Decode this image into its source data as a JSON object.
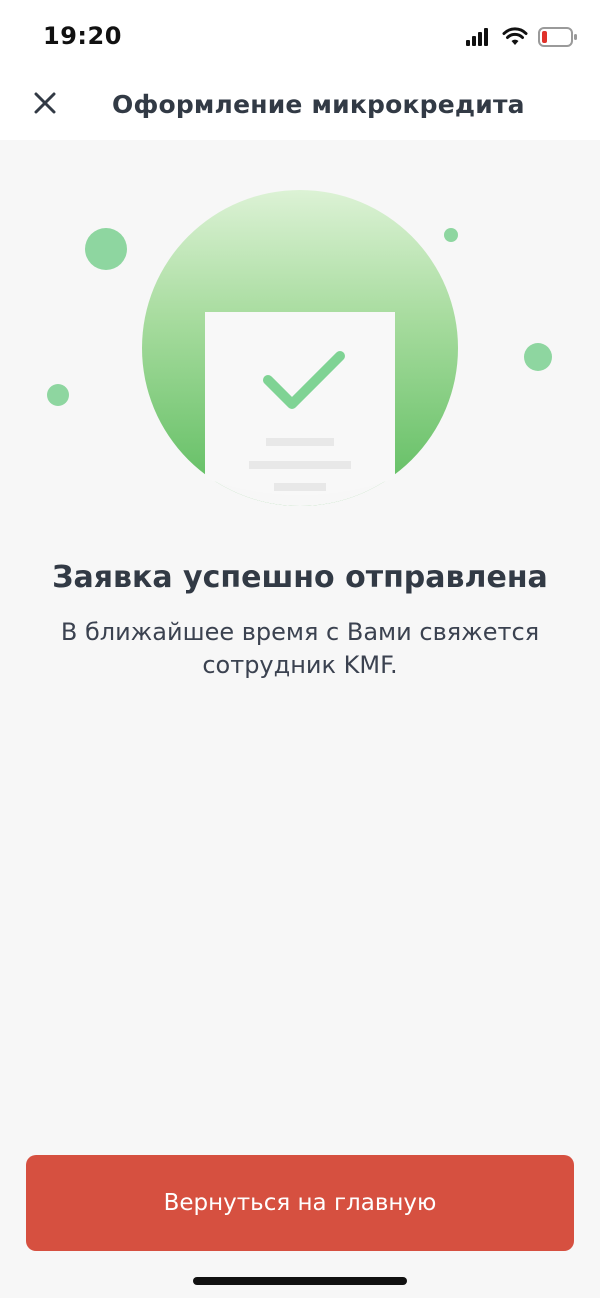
{
  "status_bar": {
    "time": "19:20",
    "icons": [
      "signal-icon",
      "wifi-icon",
      "battery-low-icon"
    ],
    "battery_color": "#e0322b"
  },
  "header": {
    "title": "Оформление микрокредита",
    "close_icon": "close-icon"
  },
  "illustration": {
    "icon": "document-check-icon",
    "accent_color": "#6cc46f"
  },
  "result": {
    "title": "Заявка успешно отправлена",
    "message_line1": "В ближайшее время с Вами свяжется",
    "message_line2": "сотрудник KMF."
  },
  "actions": {
    "home_button_label": "Вернуться на главную",
    "home_button_color": "#d65040"
  }
}
